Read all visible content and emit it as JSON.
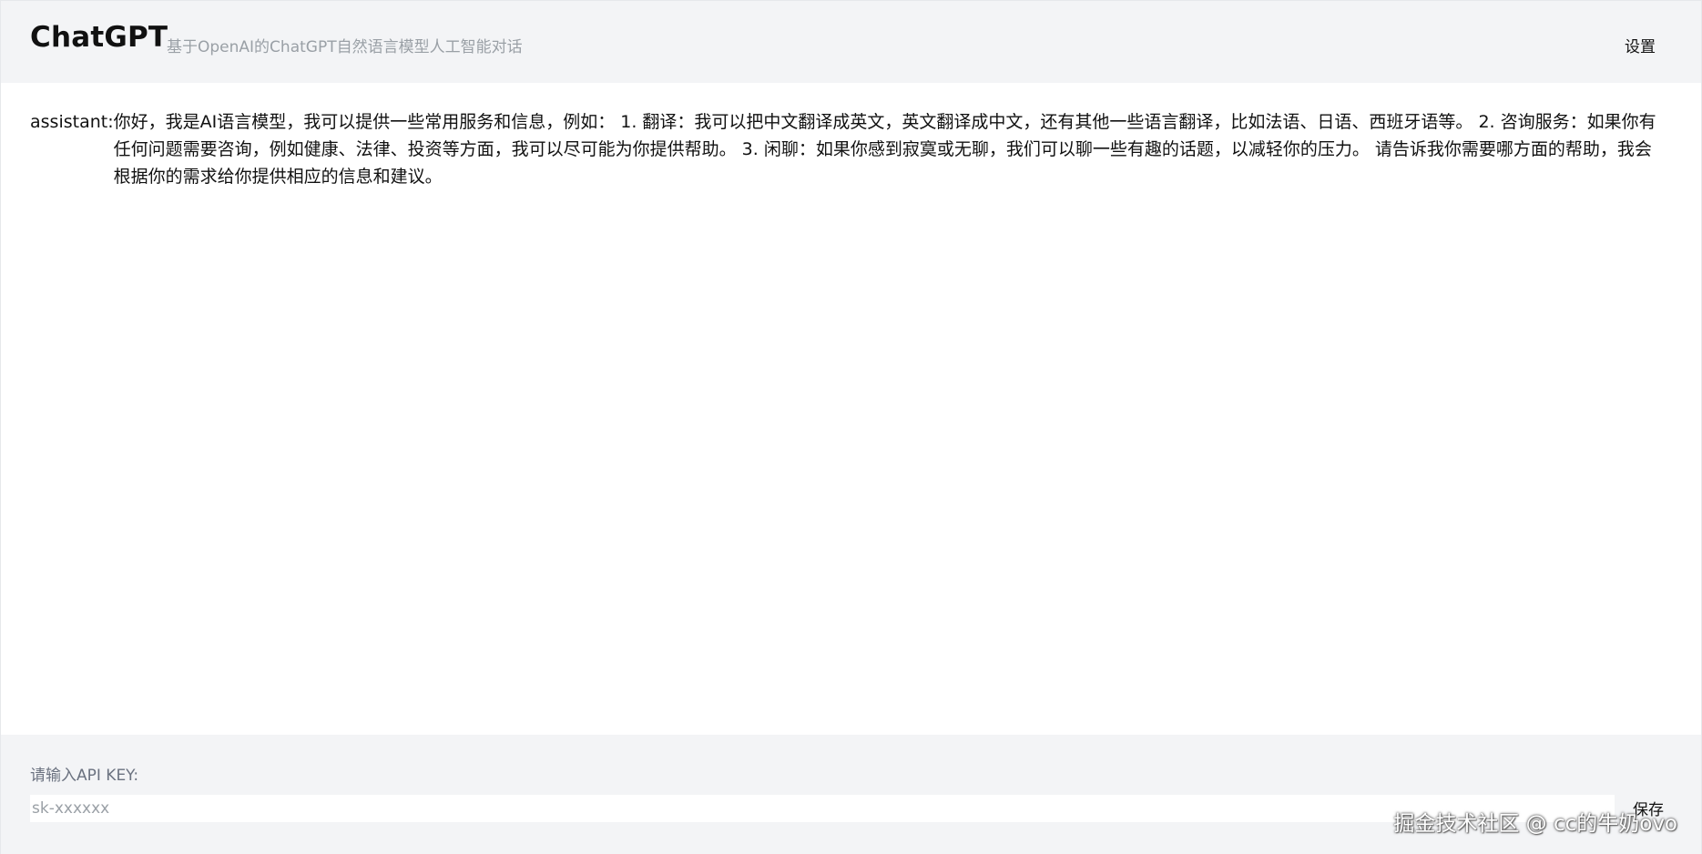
{
  "header": {
    "title": "ChatGPT",
    "subtitle": "基于OpenAI的ChatGPT自然语言模型人工智能对话",
    "settings_label": "设置"
  },
  "chat": {
    "messages": [
      {
        "role": "assistant:",
        "content": "你好，我是AI语言模型，我可以提供一些常用服务和信息，例如： 1. 翻译：我可以把中文翻译成英文，英文翻译成中文，还有其他一些语言翻译，比如法语、日语、西班牙语等。 2. 咨询服务：如果你有任何问题需要咨询，例如健康、法律、投资等方面，我可以尽可能为你提供帮助。 3. 闲聊：如果你感到寂寞或无聊，我们可以聊一些有趣的话题，以减轻你的压力。 请告诉我你需要哪方面的帮助，我会根据你的需求给你提供相应的信息和建议。"
      }
    ]
  },
  "footer": {
    "api_label": "请输入API KEY:",
    "api_value": "",
    "api_placeholder": "sk-xxxxxx",
    "save_label": "保存",
    "watermark": "掘金技术社区 @ cc的牛奶ovo"
  }
}
